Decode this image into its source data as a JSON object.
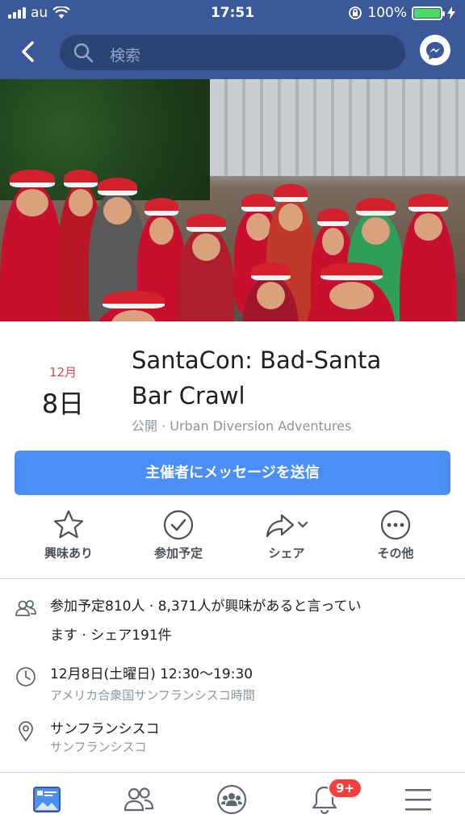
{
  "status_bar": {
    "carrier": "au",
    "time": "17:51",
    "battery": "100%"
  },
  "nav": {
    "search_placeholder": "検索",
    "icons": [
      "back-icon",
      "search-icon",
      "messenger-icon"
    ]
  },
  "event": {
    "month": "12月",
    "day": "8日",
    "title_line1": "SantaCon: Bad-Santa",
    "title_line2": "Bar Crawl",
    "meta": "公開 · Urban Diversion Adventures",
    "message_button": "主催者にメッセージを送信"
  },
  "actions": [
    {
      "label": "興味あり",
      "icon": "star-icon"
    },
    {
      "label": "参加予定",
      "icon": "check-circle-icon"
    },
    {
      "label": "シェア",
      "icon": "share-icon"
    },
    {
      "label": "その他",
      "icon": "more-icon"
    }
  ],
  "details": {
    "attendance_line1": "参加予定810人 · 8,371人が興味があると言ってい",
    "attendance_line2": "ます · シェア191件",
    "time_main": "12月8日(土曜日) 12:30〜19:30",
    "time_sub": "アメリカ合衆国サンフランシスコ時間",
    "location_main": "サンフランシスコ",
    "location_sub": "サンフランシスコ"
  },
  "tabbar": {
    "notification_badge": "9+",
    "icons": [
      "news-feed-icon",
      "friends-icon",
      "groups-icon",
      "notifications-icon",
      "menu-icon"
    ]
  },
  "colors": {
    "brand": "#3b5998",
    "button": "#4a8ef6",
    "month": "#e1464f",
    "badge": "#fa3e3e"
  }
}
